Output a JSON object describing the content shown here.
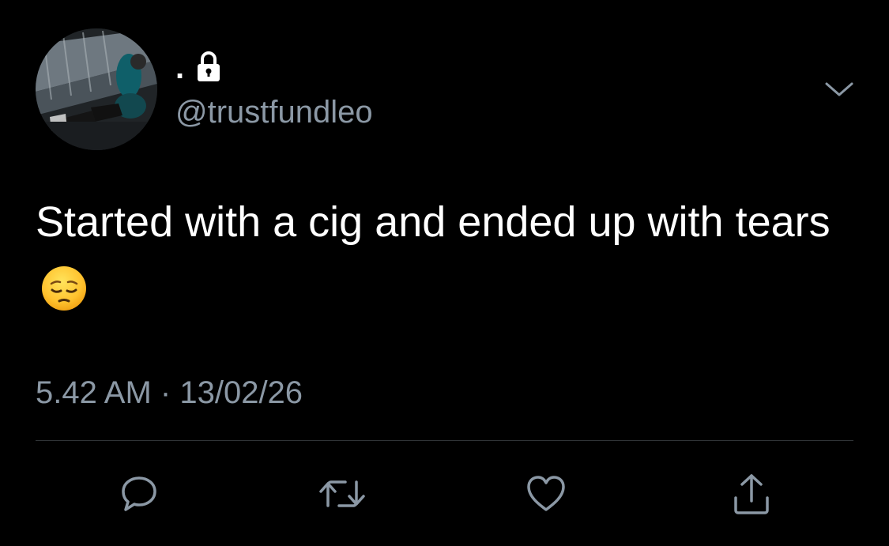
{
  "tweet": {
    "display_name": ".",
    "handle": "@trustfundleo",
    "protected": true,
    "text": "Started with a cig and ended up with tears",
    "emoji": "pensive-face-emoji",
    "time": "5.42 AM",
    "separator": "·",
    "date": "13/02/26"
  },
  "icons": {
    "lock": "lock-icon",
    "caret": "chevron-down-icon",
    "reply": "reply-icon",
    "retweet": "retweet-icon",
    "like": "heart-icon",
    "share": "share-icon"
  },
  "colors": {
    "background": "#000000",
    "primary_text": "#ffffff",
    "secondary_text": "#8b98a5",
    "divider": "#2f3336"
  }
}
